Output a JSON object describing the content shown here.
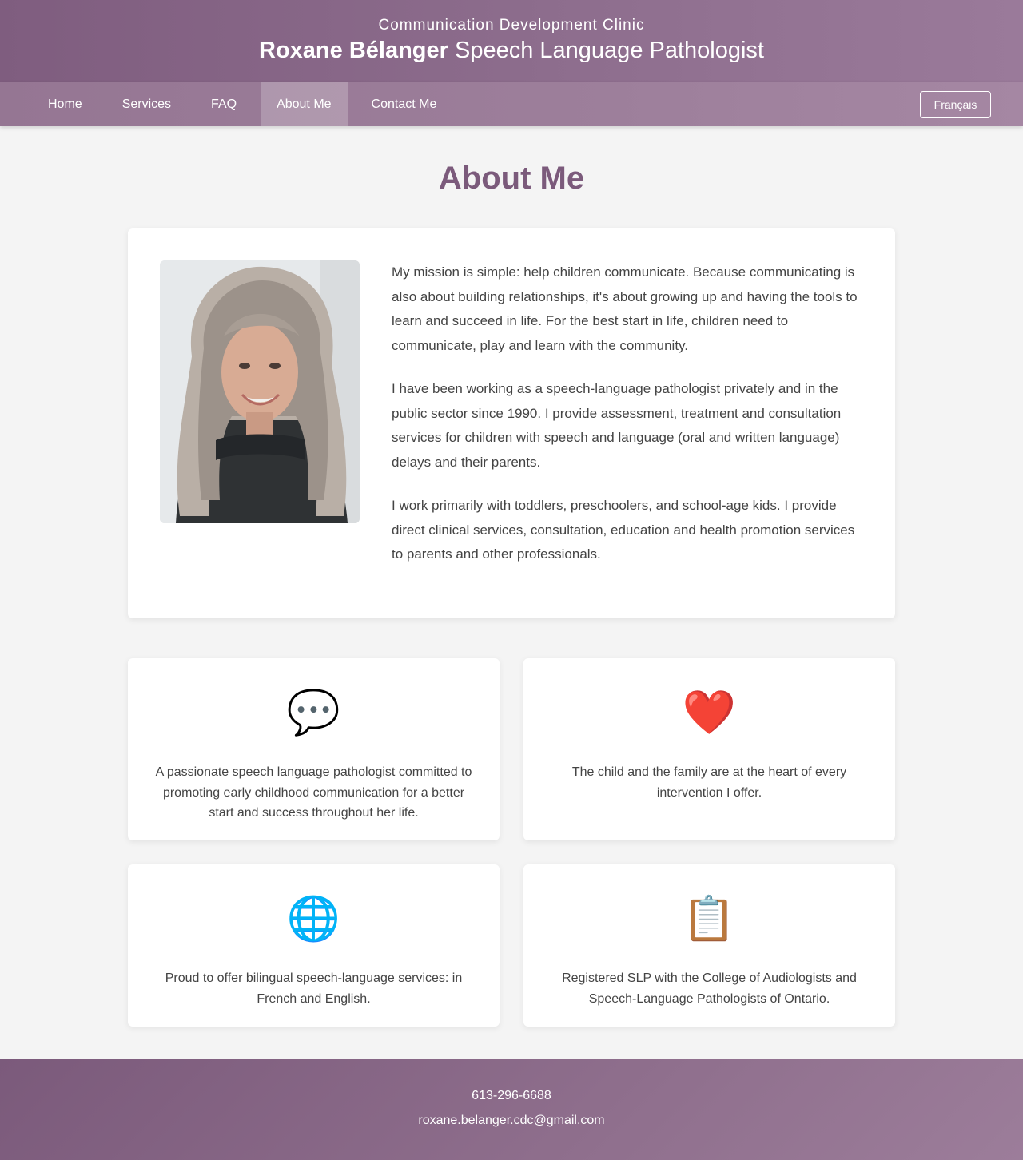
{
  "header": {
    "clinic_name": "Communication Development Clinic",
    "name": "Roxane Bélanger",
    "profession": "Speech Language Pathologist"
  },
  "nav": {
    "items": [
      {
        "label": "Home"
      },
      {
        "label": "Services"
      },
      {
        "label": "FAQ"
      },
      {
        "label": "About Me",
        "active": true
      },
      {
        "label": "Contact Me"
      }
    ],
    "language_button": "Français"
  },
  "main": {
    "title": "About Me",
    "about": {
      "paragraphs": [
        "My mission is simple: help children communicate. Because communicating is also about building relationships, it's about growing up and having the tools to learn and succeed in life. For the best start in life, children need to communicate, play and learn with the community.",
        "I have been working as a speech-language pathologist privately and in the public sector since 1990. I provide assessment, treatment and consultation services for children with speech and language (oral and written language) delays and their parents.",
        "I work primarily with toddlers, preschoolers, and school-age kids. I provide direct clinical services, consultation, education and health promotion services to parents and other professionals."
      ]
    },
    "features": [
      {
        "icon": "speech-bubble-icon",
        "glyph": "💬",
        "text": "A passionate speech language pathologist committed to promoting early childhood communication for a better start and success throughout her life."
      },
      {
        "icon": "heart-icon",
        "glyph": "❤️",
        "text": "The child and the family are at the heart of every intervention I offer."
      },
      {
        "icon": "globe-icon",
        "glyph": "🌐",
        "text": "Proud to offer bilingual speech-language services: in French and English."
      },
      {
        "icon": "clipboard-icon",
        "glyph": "📋",
        "text": "Registered SLP with the College of Audiologists and Speech-Language Pathologists of Ontario."
      }
    ]
  },
  "footer": {
    "phone": "613-296-6688",
    "email": "roxane.belanger.cdc@gmail.com"
  },
  "colors": {
    "brand": "#7b5a7b",
    "header_bg": "#8c6c8c",
    "nav_bg": "#9d7f9b",
    "page_bg": "#f4f4f4"
  }
}
